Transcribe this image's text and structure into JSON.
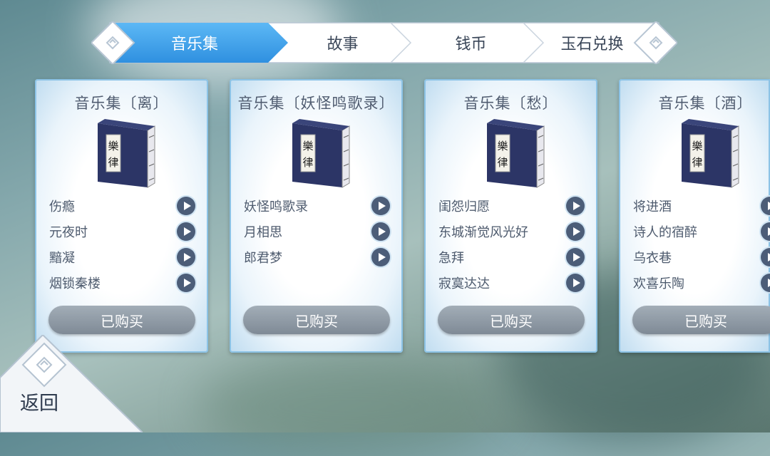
{
  "tabs": [
    {
      "label": "音乐集",
      "active": true
    },
    {
      "label": "故事",
      "active": false
    },
    {
      "label": "钱币",
      "active": false
    },
    {
      "label": "玉石兑换",
      "active": false
    }
  ],
  "cards": [
    {
      "title": "音乐集〔离〕",
      "songs": [
        "伤瘾",
        "元夜时",
        "黯凝",
        "烟锁秦楼"
      ],
      "button": "已购买",
      "book_glyphs": [
        "樂",
        "律"
      ]
    },
    {
      "title": "音乐集〔妖怪鸣歌录〕",
      "songs": [
        "妖怪鸣歌录",
        "月相思",
        "郎君梦"
      ],
      "button": "已购买",
      "book_glyphs": [
        "樂",
        "律"
      ]
    },
    {
      "title": "音乐集〔愁〕",
      "songs": [
        "闺怨归愿",
        "东城渐觉风光好",
        "急拜",
        "寂寞达达"
      ],
      "button": "已购买",
      "book_glyphs": [
        "樂",
        "律"
      ]
    },
    {
      "title": "音乐集〔酒〕",
      "songs": [
        "将进酒",
        "诗人的宿醉",
        "乌衣巷",
        "欢喜乐陶"
      ],
      "button": "已购买",
      "book_glyphs": [
        "樂",
        "律"
      ]
    }
  ],
  "back_label": "返回",
  "colors": {
    "active_tab": "#2f9be8",
    "card_border": "#8cc3e6",
    "play_button": "#4c5d78",
    "purchased_button": "#8e99a4"
  }
}
